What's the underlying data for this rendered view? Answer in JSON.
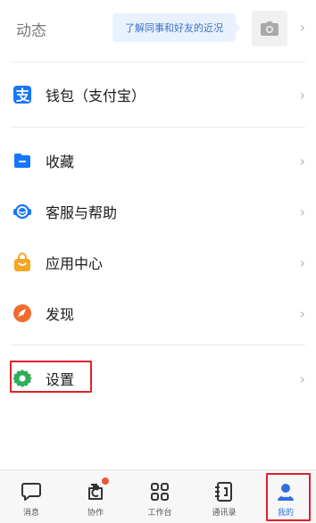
{
  "dynamics": {
    "label": "动态",
    "bubble_text": "了解同事和好友的近况",
    "camera_icon": "camera-icon"
  },
  "menu": {
    "wallet": {
      "label": "钱包（支付宝）",
      "icon": "alipay-icon",
      "color": "#1677ff"
    },
    "favorites": {
      "label": "收藏",
      "icon": "folder-icon",
      "color": "#1677ff"
    },
    "support": {
      "label": "客服与帮助",
      "icon": "headset-icon",
      "color": "#1677ff"
    },
    "app_center": {
      "label": "应用中心",
      "icon": "bag-icon",
      "color": "#f5a623"
    },
    "discover": {
      "label": "发现",
      "icon": "compass-icon",
      "color": "#f26b2c"
    },
    "settings": {
      "label": "设置",
      "icon": "gear-icon",
      "color": "#2fae58"
    }
  },
  "tabbar": {
    "tabs": [
      {
        "label": "消息",
        "icon": "chat-bubble-icon"
      },
      {
        "label": "协作",
        "icon": "collaborate-icon"
      },
      {
        "label": "工作台",
        "icon": "grid-icon"
      },
      {
        "label": "通讯录",
        "icon": "contacts-book-icon"
      },
      {
        "label": "我的",
        "icon": "person-icon"
      }
    ],
    "active_tab": "我的",
    "accent_color": "#2f6fde",
    "badge_color": "#f0563a"
  },
  "annotation_color": "#e0202a"
}
